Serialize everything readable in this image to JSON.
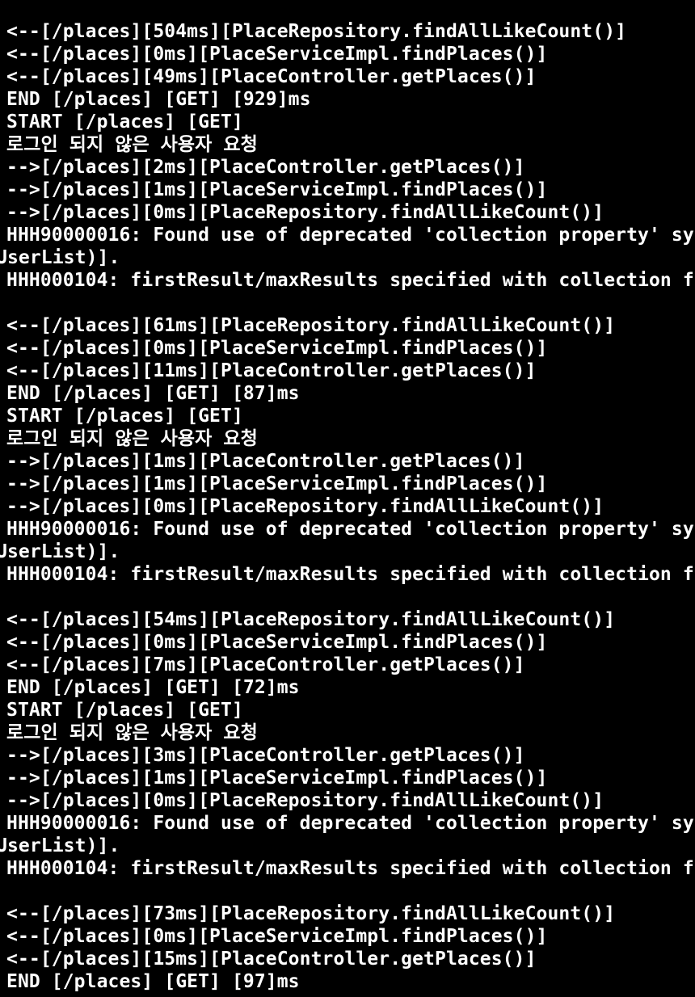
{
  "terminal": {
    "lines": [
      {
        "text": "<--[/places][504ms][PlaceRepository.findAllLikeCount()]",
        "cont": false
      },
      {
        "text": "<--[/places][0ms][PlaceServiceImpl.findPlaces()]",
        "cont": false
      },
      {
        "text": "<--[/places][49ms][PlaceController.getPlaces()]",
        "cont": false
      },
      {
        "text": "END [/places] [GET] [929]ms",
        "cont": false
      },
      {
        "text": "START [/places] [GET]",
        "cont": false
      },
      {
        "text": "로그인 되지 않은 사용자 요청",
        "cont": false
      },
      {
        "text": "-->[/places][2ms][PlaceController.getPlaces()]",
        "cont": false
      },
      {
        "text": "-->[/places][1ms][PlaceServiceImpl.findPlaces()]",
        "cont": false
      },
      {
        "text": "-->[/places][0ms][PlaceRepository.findAllLikeCount()]",
        "cont": false
      },
      {
        "text": "HHH90000016: Found use of deprecated 'collection property' sy",
        "cont": false
      },
      {
        "text": "UserList)].",
        "cont": true
      },
      {
        "text": "HHH000104: firstResult/maxResults specified with collection f",
        "cont": false
      },
      {
        "text": "",
        "cont": false
      },
      {
        "text": "<--[/places][61ms][PlaceRepository.findAllLikeCount()]",
        "cont": false
      },
      {
        "text": "<--[/places][0ms][PlaceServiceImpl.findPlaces()]",
        "cont": false
      },
      {
        "text": "<--[/places][11ms][PlaceController.getPlaces()]",
        "cont": false
      },
      {
        "text": "END [/places] [GET] [87]ms",
        "cont": false
      },
      {
        "text": "START [/places] [GET]",
        "cont": false
      },
      {
        "text": "로그인 되지 않은 사용자 요청",
        "cont": false
      },
      {
        "text": "-->[/places][1ms][PlaceController.getPlaces()]",
        "cont": false
      },
      {
        "text": "-->[/places][1ms][PlaceServiceImpl.findPlaces()]",
        "cont": false
      },
      {
        "text": "-->[/places][0ms][PlaceRepository.findAllLikeCount()]",
        "cont": false
      },
      {
        "text": "HHH90000016: Found use of deprecated 'collection property' sy",
        "cont": false
      },
      {
        "text": "UserList)].",
        "cont": true
      },
      {
        "text": "HHH000104: firstResult/maxResults specified with collection f",
        "cont": false
      },
      {
        "text": "",
        "cont": false
      },
      {
        "text": "<--[/places][54ms][PlaceRepository.findAllLikeCount()]",
        "cont": false
      },
      {
        "text": "<--[/places][0ms][PlaceServiceImpl.findPlaces()]",
        "cont": false
      },
      {
        "text": "<--[/places][7ms][PlaceController.getPlaces()]",
        "cont": false
      },
      {
        "text": "END [/places] [GET] [72]ms",
        "cont": false
      },
      {
        "text": "START [/places] [GET]",
        "cont": false
      },
      {
        "text": "로그인 되지 않은 사용자 요청",
        "cont": false
      },
      {
        "text": "-->[/places][3ms][PlaceController.getPlaces()]",
        "cont": false
      },
      {
        "text": "-->[/places][1ms][PlaceServiceImpl.findPlaces()]",
        "cont": false
      },
      {
        "text": "-->[/places][0ms][PlaceRepository.findAllLikeCount()]",
        "cont": false
      },
      {
        "text": "HHH90000016: Found use of deprecated 'collection property' sy",
        "cont": false
      },
      {
        "text": "UserList)].",
        "cont": true
      },
      {
        "text": "HHH000104: firstResult/maxResults specified with collection f",
        "cont": false
      },
      {
        "text": "",
        "cont": false
      },
      {
        "text": "<--[/places][73ms][PlaceRepository.findAllLikeCount()]",
        "cont": false
      },
      {
        "text": "<--[/places][0ms][PlaceServiceImpl.findPlaces()]",
        "cont": false
      },
      {
        "text": "<--[/places][15ms][PlaceController.getPlaces()]",
        "cont": false
      },
      {
        "text": "END [/places] [GET] [97]ms",
        "cont": false
      }
    ]
  }
}
